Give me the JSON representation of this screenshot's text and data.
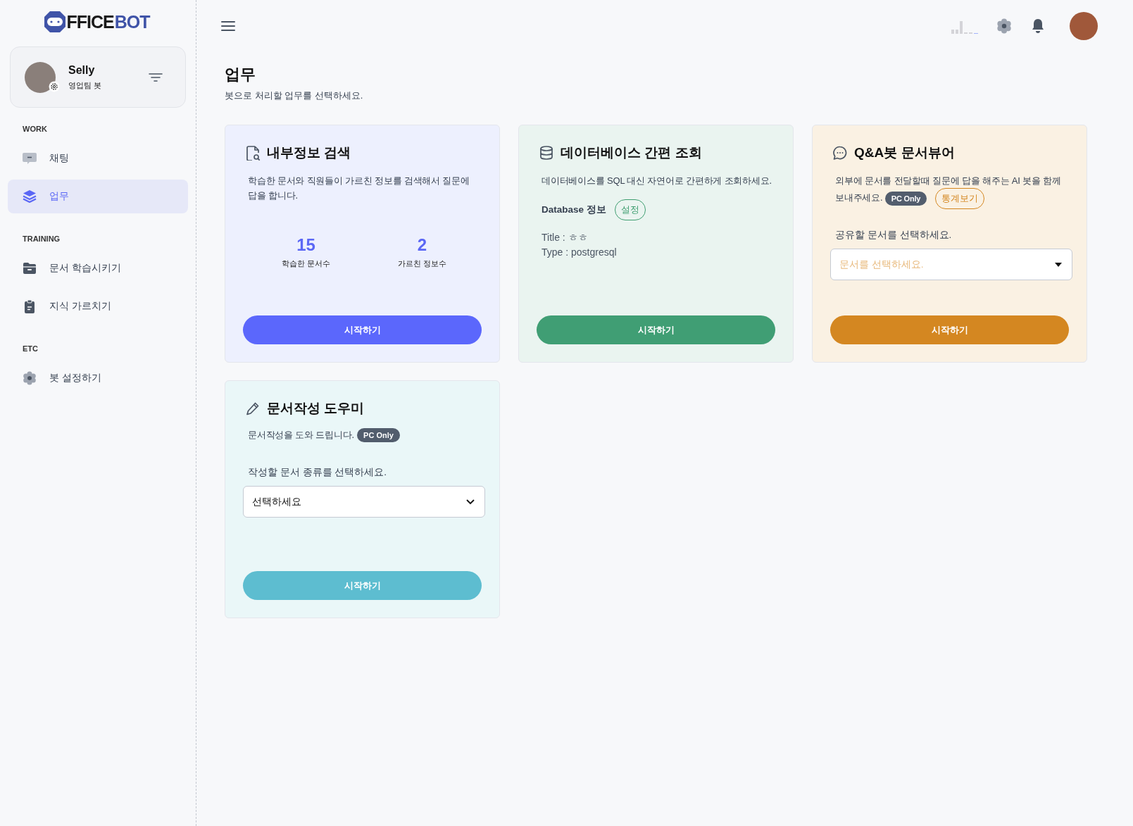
{
  "logo": {
    "text_dark": "FFICE",
    "text_accent": "BOT"
  },
  "profile": {
    "name": "Selly",
    "role": "영업팀 봇"
  },
  "sidebar": {
    "sections": [
      {
        "label": "WORK",
        "items": [
          {
            "label": "채팅",
            "kind": "chat",
            "selected": false
          },
          {
            "label": "업무",
            "kind": "tasks",
            "selected": true
          }
        ]
      },
      {
        "label": "TRAINING",
        "items": [
          {
            "label": "문서 학습시키기",
            "kind": "documents",
            "selected": false
          },
          {
            "label": "지식 가르치기",
            "kind": "knowledge",
            "selected": false
          }
        ]
      },
      {
        "label": "ETC",
        "items": [
          {
            "label": "봇 설정하기",
            "kind": "settings",
            "selected": false
          }
        ]
      }
    ]
  },
  "page": {
    "title": "업무",
    "subtitle": "봇으로 처리할 업무를 선택하세요."
  },
  "cards": [
    {
      "kind": "stats",
      "title": "내부정보 검색",
      "description": "학습한 문서와 직원들이 가르친 정보를 검색해서 질문에 답을 합니다.",
      "stats": [
        {
          "value": "15",
          "label": "학습한 문서수"
        },
        {
          "value": "2",
          "label": "가르친 정보수"
        }
      ],
      "button": "시작하기"
    },
    {
      "kind": "database",
      "title": "데이터베이스 간편 조회",
      "description": "데이터베이스를 SQL 대신 자연어로 간편하게 조회하세요.",
      "info_label": "Database 정보",
      "info_button": "설정",
      "info_lines": [
        "Title : ㅎㅎ",
        "Type : postgresql"
      ],
      "button": "시작하기"
    },
    {
      "kind": "viewer",
      "title": "Q&A봇 문서뷰어",
      "description": "외부에 문서를 전달할때 질문에 답을 해주는 AI 봇을 함께 보내주세요.",
      "badge": "PC Only",
      "link_button": "통계보기",
      "select_label": "공유할 문서를 선택하세요.",
      "select": {
        "placeholder": "문서를 선택하세요."
      },
      "button": "시작하기"
    },
    {
      "kind": "writer",
      "title": "문서작성 도우미",
      "description": "문서작성을 도와 드립니다.",
      "badge": "PC Only",
      "select_label": "작성할 문서 종류를 선택하세요.",
      "select": {
        "value": "선택하세요"
      },
      "button": "시작하기"
    }
  ]
}
